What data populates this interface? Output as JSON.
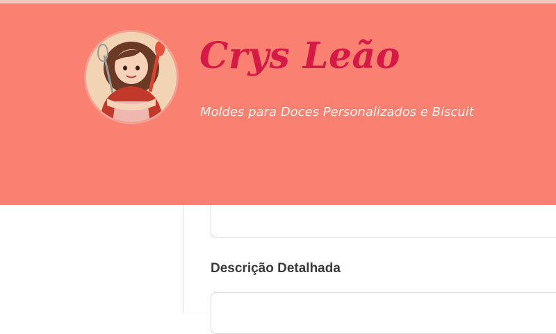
{
  "header": {
    "title": "Crys Leão",
    "subtitle": "Moldes para Doces Personalizados e Biscuit",
    "avatar_icon": "chef-avatar-icon",
    "background_color": "#fa8072",
    "title_color": "#d61a46"
  },
  "form": {
    "description_label": "Descrição Detalhada",
    "description_value": ""
  }
}
